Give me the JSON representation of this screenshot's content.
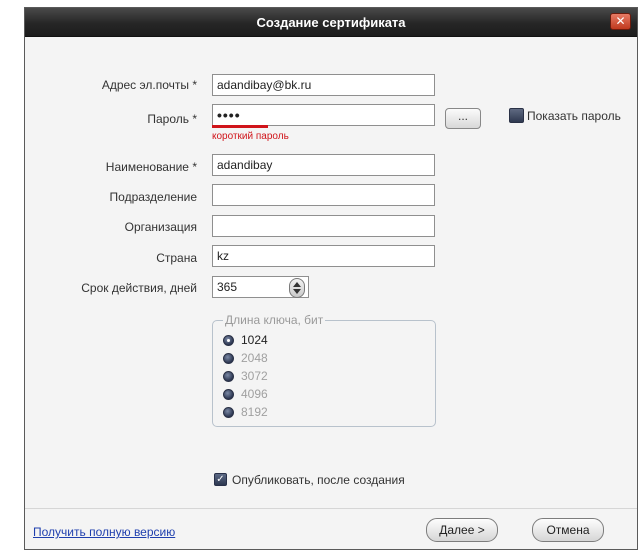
{
  "window": {
    "title": "Создание сертификата",
    "close_symbol": "✕"
  },
  "form": {
    "email_label": "Адрес эл.почты *",
    "email_value": "adandibay@bk.ru",
    "password_label": "Пароль *",
    "password_value": "••••",
    "password_hint": "короткий пароль",
    "password_generate_label": "...",
    "show_password_label": "Показать пароль",
    "name_label": "Наименование *",
    "name_value": "adandibay",
    "department_label": "Подразделение",
    "department_value": "",
    "organization_label": "Организация",
    "organization_value": "",
    "country_label": "Страна",
    "country_value": "kz",
    "validity_label": "Срок действия, дней",
    "validity_value": "365"
  },
  "key_length": {
    "title": "Длина ключа, бит",
    "options": [
      "1024",
      "2048",
      "3072",
      "4096",
      "8192"
    ],
    "selected": "1024"
  },
  "publish": {
    "label": "Опубликовать, после создания",
    "checked": true,
    "check_symbol": "✓"
  },
  "footer": {
    "full_version_link": "Получить полную версию",
    "next_label": "Далее >",
    "cancel_label": "Отмена"
  },
  "colors": {
    "error": "#d0141a",
    "link": "#1f3fae",
    "titlebar": "#262626"
  }
}
